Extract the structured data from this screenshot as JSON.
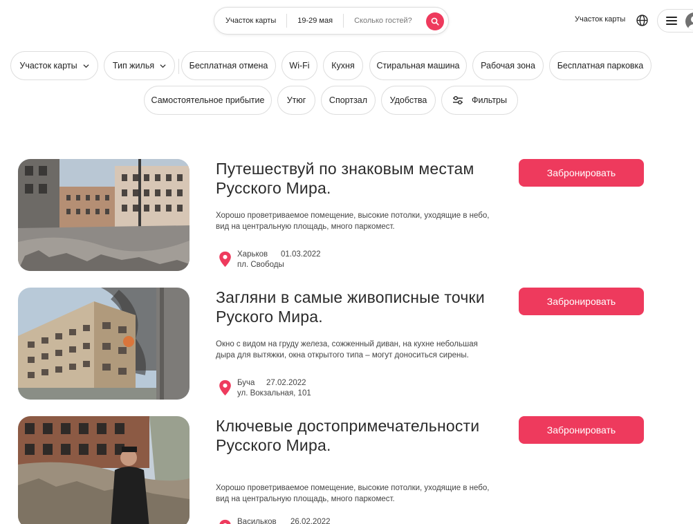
{
  "search": {
    "location": "Участок карты",
    "dates": "19-29 мая",
    "guests_placeholder": "Сколько гостей?"
  },
  "header": {
    "right_label": "Участок карты"
  },
  "filters": {
    "row1": [
      {
        "label": "Участок карты",
        "dropdown": true
      },
      {
        "label": "Тип жилья",
        "dropdown": true
      },
      {
        "label": "Бесплатная отмена"
      },
      {
        "label": "Wi-Fi"
      },
      {
        "label": "Кухня"
      },
      {
        "label": "Стиральная машина"
      },
      {
        "label": "Рабочая зона"
      },
      {
        "label": "Бесплатная парковка"
      }
    ],
    "row2": [
      {
        "label": "Самостоятельное прибытие"
      },
      {
        "label": "Утюг"
      },
      {
        "label": "Спортзал"
      },
      {
        "label": "Удобства"
      },
      {
        "label": "Фильтры",
        "icon": "sliders-icon"
      }
    ]
  },
  "listings": [
    {
      "title": "Путешествуй по знаковым местам Русского Мира.",
      "description": "Хорошо проветриваемое помещение, высокие потолки, уходящие в небо, вид на центральную площадь, много паркомест.",
      "city": "Харьков",
      "date": "01.03.2022",
      "address": "пл. Свободы",
      "button": "Забронировать",
      "image": "destroyed-square-photo"
    },
    {
      "title": "Загляни в самые живописные точки Руского Мира.",
      "description": "Окно с видом на груду железа, сожженный диван, на кухне небольшая дыра для вытяжки, окна открытого типа – могут доноситься сирены.",
      "city": "Буча",
      "date": "27.02.2022",
      "address": "ул. Вокзальная, 101",
      "button": "Забронировать",
      "image": "burning-building-photo"
    },
    {
      "title": "Ключевые достопримечательности Русского Мира.",
      "description": "Хорошо проветриваемое помещение, высокие потолки, уходящие в небо, вид на центральную площадь, много паркомест.",
      "city": "Васильков",
      "date": "26.02.2022",
      "address": "",
      "button": "Забронировать",
      "image": "ruined-building-man-photo"
    }
  ],
  "colors": {
    "accent": "#ee3a5d",
    "border": "#dddddd",
    "text": "#222222"
  }
}
